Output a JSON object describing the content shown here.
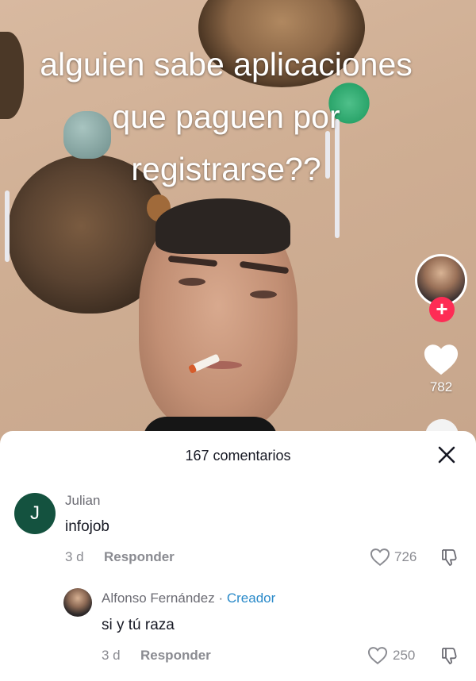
{
  "video": {
    "caption_lines": [
      "alguien sabe aplicaciones",
      "que paguen por",
      "registrarse??"
    ],
    "like_count": "782"
  },
  "comments_sheet": {
    "title": "167 comentarios",
    "comments": [
      {
        "avatar_letter": "J",
        "username": "Julian",
        "text": "infojob",
        "time": "3 d",
        "reply_label": "Responder",
        "likes": "726"
      },
      {
        "username": "Alfonso Fernández",
        "separator": "·",
        "badge": "Creador",
        "text": "si y tú raza",
        "time": "3 d",
        "reply_label": "Responder",
        "likes": "250"
      }
    ]
  },
  "colors": {
    "follow_red": "#fe2c55",
    "creator_blue": "#2a8ac9",
    "avatar_green": "#14523f"
  },
  "icons": [
    "heart-icon",
    "plus-icon",
    "close-icon",
    "heart-outline-icon",
    "dislike-icon"
  ]
}
